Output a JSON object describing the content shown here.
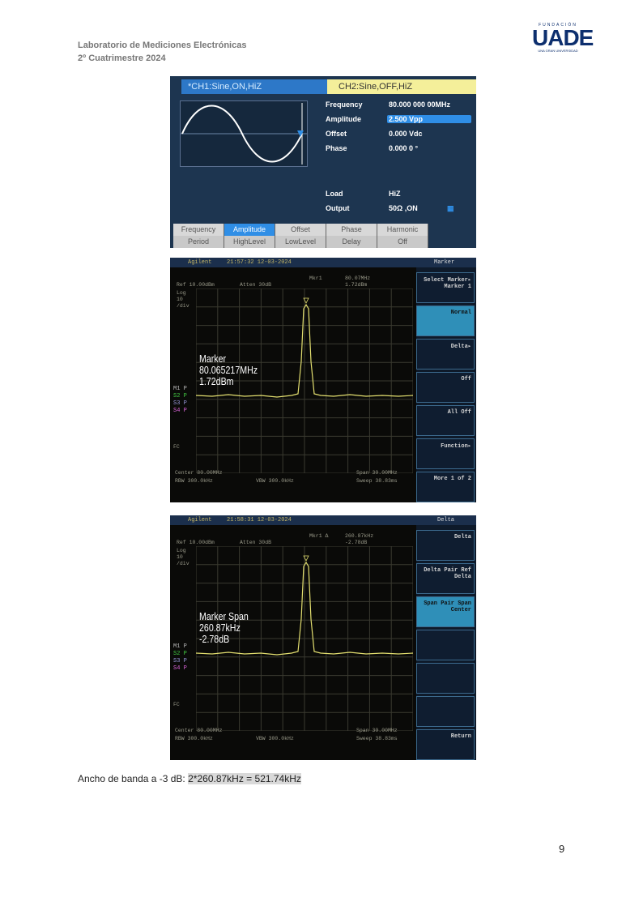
{
  "header": {
    "line1": "Laboratorio de Mediciones Electrónicas",
    "line2": "2º Cuatrimestre 2024"
  },
  "logo": {
    "top": "FUNDACIÓN",
    "name": "UADE",
    "sub": "UNA GRAN UNIVERSIDAD"
  },
  "generator": {
    "ch1": "*CH1:Sine,ON,HiZ",
    "ch2": "CH2:Sine,OFF,HiZ",
    "params": [
      {
        "label": "Frequency",
        "value": "80.000 000 00MHz"
      },
      {
        "label": "Amplitude",
        "value": "2.500 Vpp"
      },
      {
        "label": "Offset",
        "value": "0.000 Vdc"
      },
      {
        "label": "Phase",
        "value": "0.000 0 °"
      }
    ],
    "load": {
      "label": "Load",
      "value": "HiZ"
    },
    "output": {
      "label": "Output",
      "value": "50Ω ,ON"
    },
    "softkeys": [
      {
        "top": "Frequency",
        "bottom": "Period"
      },
      {
        "top": "Amplitude",
        "bottom": "HighLevel"
      },
      {
        "top": "Offset",
        "bottom": "LowLevel"
      },
      {
        "top": "Phase",
        "bottom": "Delay"
      },
      {
        "top": "Harmonic",
        "bottom": "Off"
      }
    ]
  },
  "spectrum1": {
    "brand": "Agilent",
    "time": "21:57:32 12-03-2024",
    "mode": "Marker",
    "ref": "Ref 10.00dBm",
    "atten": "Atten 30dB",
    "mkr": "Mkr1",
    "mkr_freq": "80.07MHz",
    "mkr_amp": "1.72dBm",
    "log": "Log",
    "scale": "10",
    "div": "/div",
    "marker_text": [
      "Marker",
      "80.065217MHz",
      "1.72dBm"
    ],
    "center": "Center 80.00MHz",
    "span": "Span 30.00MHz",
    "rbw": "RBW 300.0kHz",
    "vbw": "VBW 300.0kHz",
    "sweep": "Sweep 38.83ms",
    "fc": "FC",
    "keys": [
      "Select Marker▸ Marker 1",
      "Normal",
      "Delta▸",
      "Off",
      "All Off",
      "Function▸",
      "More 1 of 2"
    ]
  },
  "spectrum2": {
    "brand": "Agilent",
    "time": "21:58:31 12-03-2024",
    "mode": "Delta",
    "ref": "Ref 10.00dBm",
    "atten": "Atten 30dB",
    "mkr": "Mkr1 Δ",
    "mkr_freq": "260.87kHz",
    "mkr_amp": "-2.78dB",
    "log": "Log",
    "scale": "10",
    "div": "/div",
    "marker_text": [
      "Marker  Span",
      "260.87kHz",
      "-2.78dB"
    ],
    "center": "Center 80.00MHz",
    "span": "Span 30.00MHz",
    "rbw": "RBW 300.0kHz",
    "vbw": "VBW 300.0kHz",
    "sweep": "Sweep 38.83ms",
    "fc": "FC",
    "keys": [
      "Delta",
      "Delta Pair Ref Delta",
      "Span Pair Span Center",
      "",
      "",
      "",
      "Return"
    ]
  },
  "marker_labels": [
    "M1 P",
    "S2 P",
    "S3 P",
    "S4 P"
  ],
  "caption": {
    "text": "Ancho de banda a -3 dB:",
    "highlight": "2*260.87kHz = 521.74kHz"
  },
  "page_number": "9"
}
